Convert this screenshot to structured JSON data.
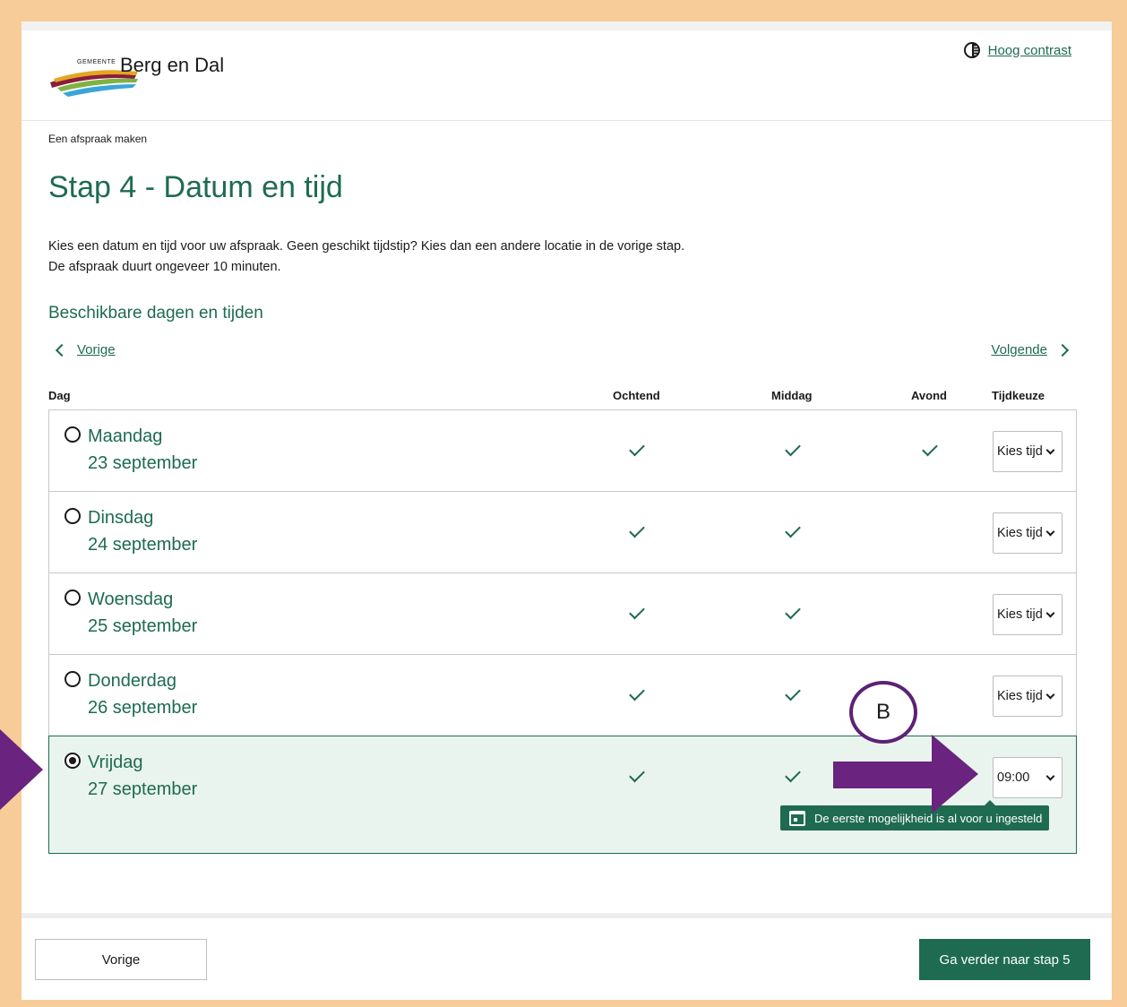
{
  "header": {
    "logo_small": "GEMEENTE",
    "logo_big": "Berg en Dal",
    "contrast_link": "Hoog contrast"
  },
  "breadcrumb": "Een afspraak maken",
  "page_title": "Stap 4 - Datum en tijd",
  "intro": {
    "line1": "Kies een datum en tijd voor uw afspraak. Geen geschikt tijdstip? Kies dan een andere locatie in de vorige stap.",
    "line2": "De afspraak duurt ongeveer 10 minuten."
  },
  "section_title": "Beschikbare dagen en tijden",
  "nav": {
    "prev": "Vorige",
    "next": "Volgende"
  },
  "columns": {
    "day": "Dag",
    "morning": "Ochtend",
    "afternoon": "Middag",
    "evening": "Avond",
    "time_choice": "Tijdkeuze"
  },
  "rows": [
    {
      "day": "Maandag",
      "date": "23 september",
      "morning": true,
      "afternoon": true,
      "evening": true,
      "time": "Kies tijd",
      "selected": false
    },
    {
      "day": "Dinsdag",
      "date": "24 september",
      "morning": true,
      "afternoon": true,
      "evening": false,
      "time": "Kies tijd",
      "selected": false
    },
    {
      "day": "Woensdag",
      "date": "25 september",
      "morning": true,
      "afternoon": true,
      "evening": false,
      "time": "Kies tijd",
      "selected": false
    },
    {
      "day": "Donderdag",
      "date": "26 september",
      "morning": true,
      "afternoon": true,
      "evening": false,
      "time": "Kies tijd",
      "selected": false
    },
    {
      "day": "Vrijdag",
      "date": "27 september",
      "morning": true,
      "afternoon": true,
      "evening": false,
      "time": "09:00",
      "selected": true
    }
  ],
  "tooltip": "De eerste mogelijkheid is al voor u ingesteld",
  "footer": {
    "prev_button": "Vorige",
    "next_button": "Ga verder naar stap 5"
  },
  "annotation": {
    "label": "B",
    "color": "#5c2275"
  },
  "colors": {
    "brand_green": "#1e6b51",
    "frame": "#f7cc98",
    "selected_row": "#eaf4ef"
  }
}
